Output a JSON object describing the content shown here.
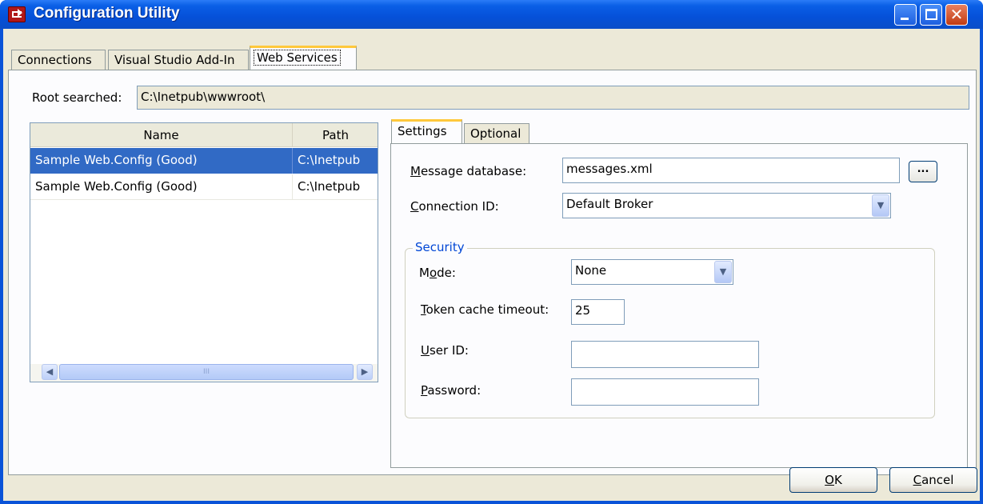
{
  "window": {
    "title": "Configuration Utility"
  },
  "top_tabs": [
    {
      "label": "Connections",
      "active": false
    },
    {
      "label": "Visual Studio Add-In",
      "active": false
    },
    {
      "label": "Web Services",
      "active": true
    }
  ],
  "root": {
    "label": "Root searched:",
    "value": "C:\\Inetpub\\wwwroot\\"
  },
  "list": {
    "columns": [
      "Name",
      "Path"
    ],
    "rows": [
      {
        "name": "Sample Web.Config (Good)",
        "path": "C:\\Inetpub",
        "selected": true
      },
      {
        "name": "Sample Web.Config (Good)",
        "path": "C:\\Inetpub",
        "selected": false
      }
    ],
    "scroll_thumb_glyph": "III"
  },
  "inner_tabs": [
    {
      "label": "Settings",
      "active": true
    },
    {
      "label": "Optional",
      "active": false
    }
  ],
  "settings": {
    "message_database": {
      "label": "Message database:",
      "value": "messages.xml",
      "browse_label": "..."
    },
    "connection_id": {
      "label": "Connection ID:",
      "value": "Default Broker"
    },
    "security": {
      "title": "Security",
      "mode": {
        "label": "Mode:",
        "value": "None"
      },
      "token_cache_timeout": {
        "label": "Token cache timeout:",
        "value": "25"
      },
      "user_id": {
        "label": "User ID:",
        "value": ""
      },
      "password": {
        "label": "Password:",
        "value": ""
      }
    }
  },
  "buttons": {
    "ok": "OK",
    "cancel": "Cancel"
  },
  "colors": {
    "accent": "#316ac5",
    "titlebar": "#0a53d8",
    "group_title": "#0046d5",
    "tab_highlight": "#ffc83c"
  }
}
